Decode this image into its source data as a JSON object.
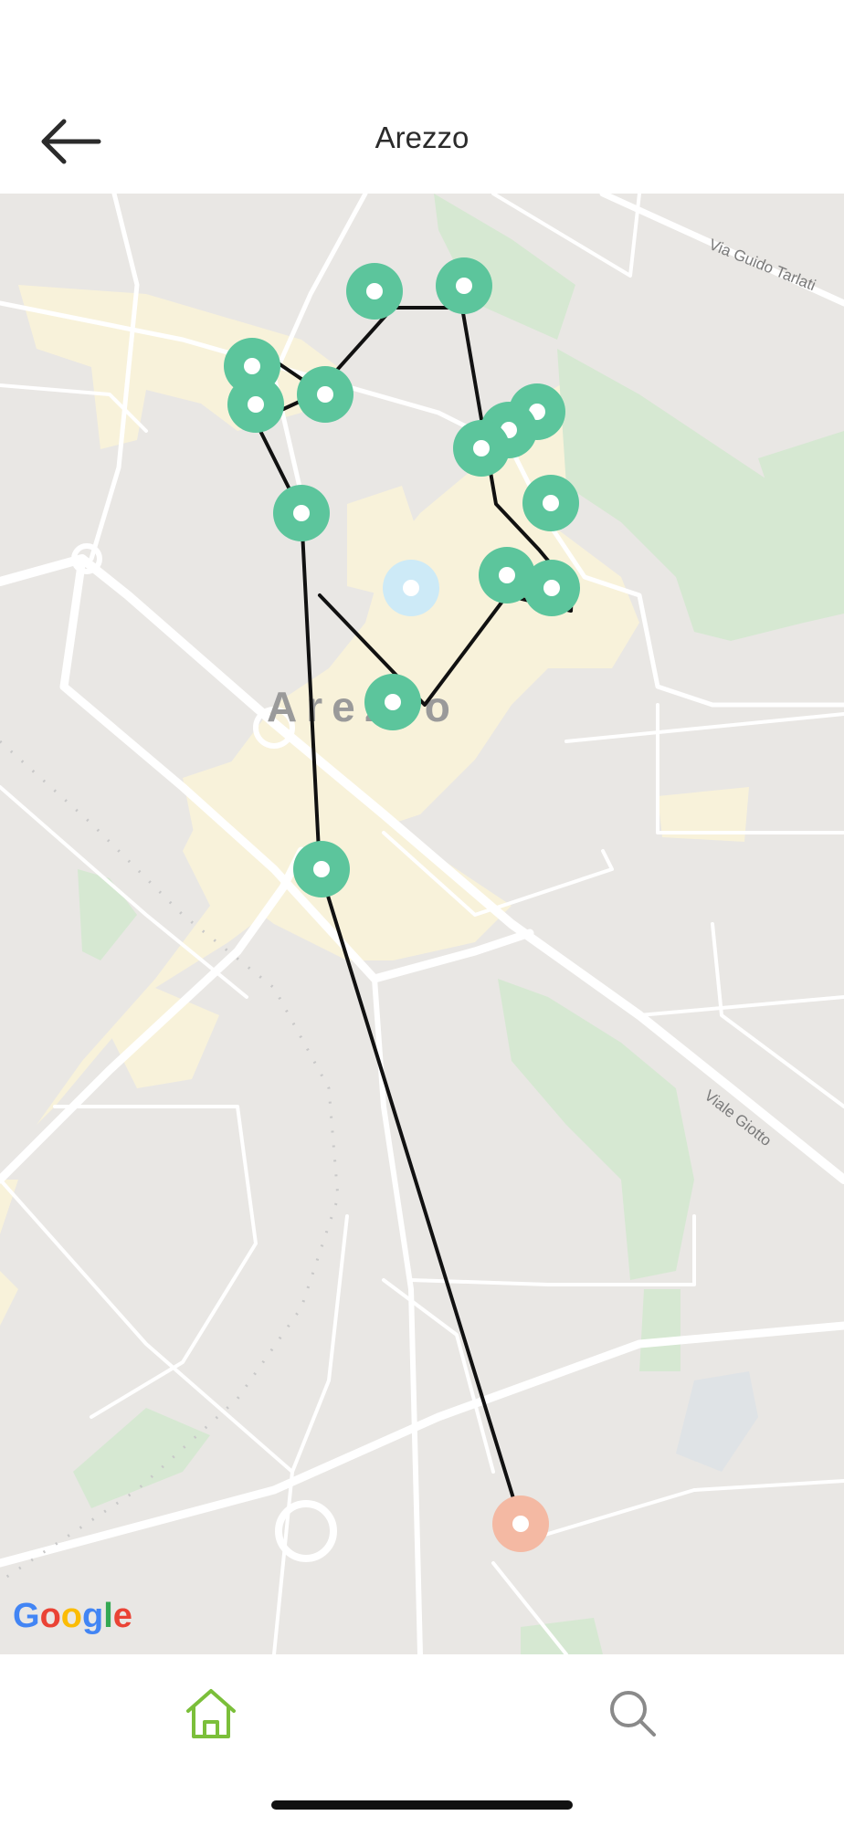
{
  "header": {
    "title": "Arezzo",
    "back_icon": "arrow-left-icon"
  },
  "map": {
    "city_label": "Arezzo",
    "street_labels": [
      "Via Guido Tarlati",
      "Viale Giotto"
    ],
    "attribution": "Google",
    "route_color": "#111111",
    "marker_colors": {
      "stop": "#5cc59c",
      "current": "#cdeaf7",
      "start": "#f4b9a3"
    },
    "stop_count": 16
  },
  "bottom_nav": {
    "items": [
      {
        "name": "home",
        "icon": "home-icon",
        "active": true,
        "color": "#7bbf3a"
      },
      {
        "name": "search",
        "icon": "search-icon",
        "active": false,
        "color": "#8a8a8a"
      }
    ]
  }
}
